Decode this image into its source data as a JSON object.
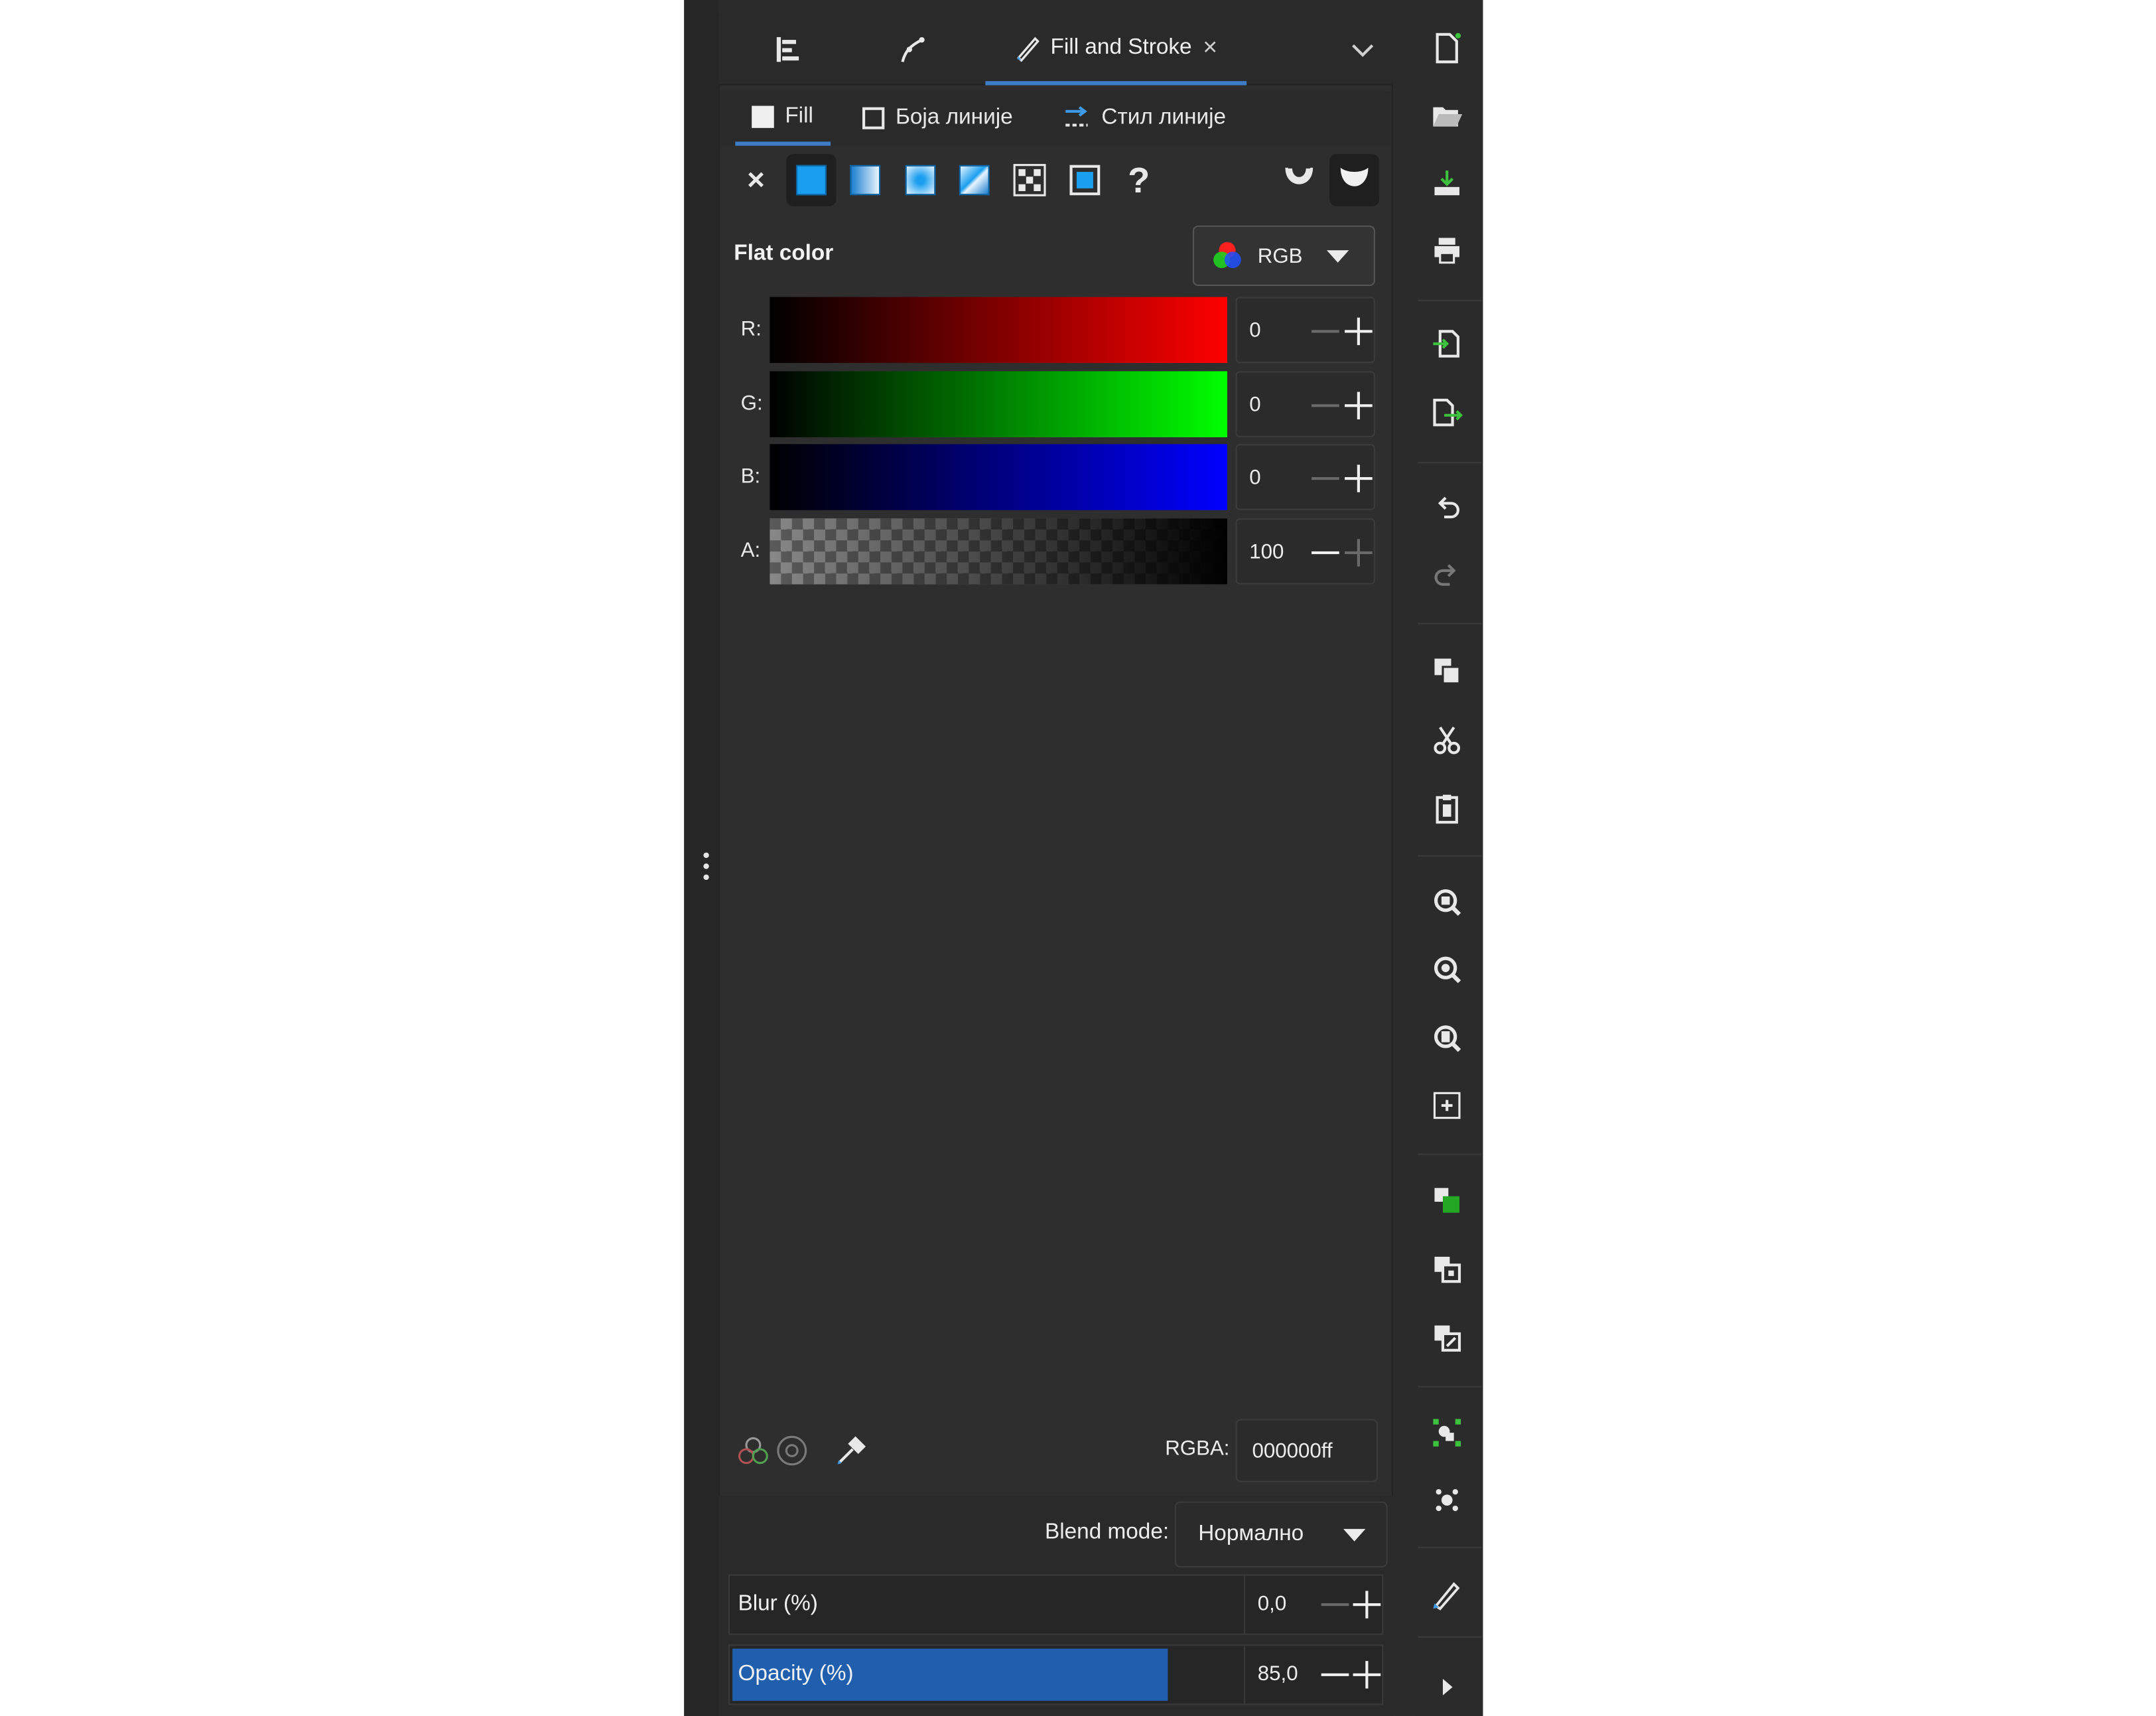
{
  "dock_tabs": [
    {
      "icon": "align-icon",
      "label": ""
    },
    {
      "icon": "node-edit-icon",
      "label": ""
    },
    {
      "icon": "fill-stroke-icon",
      "label": "Fill and Stroke",
      "active": true,
      "close": "×"
    }
  ],
  "sub_tabs": [
    {
      "label": "Fill",
      "active": true
    },
    {
      "label": "Боја линије",
      "active": false
    },
    {
      "label": "Стил линије",
      "active": false
    }
  ],
  "paint_types": [
    {
      "name": "no-paint",
      "glyph": "×"
    },
    {
      "name": "flat-color",
      "active": true
    },
    {
      "name": "linear-gradient"
    },
    {
      "name": "radial-gradient"
    },
    {
      "name": "mesh-gradient"
    },
    {
      "name": "pattern"
    },
    {
      "name": "swatch"
    },
    {
      "name": "unset",
      "glyph": "?"
    }
  ],
  "fill_rule_icons": [
    "fill-rule-evenodd-icon",
    "fill-rule-nonzero-icon"
  ],
  "flat_color": {
    "label": "Flat color",
    "mode": "RGB",
    "channels": [
      {
        "label": "R:",
        "value": "0",
        "color": "#ff0000"
      },
      {
        "label": "G:",
        "value": "0",
        "color": "#00ff00"
      },
      {
        "label": "B:",
        "value": "0",
        "color": "#0000ff"
      },
      {
        "label": "A:",
        "value": "100",
        "color": "#000000"
      }
    ],
    "rgba_label": "RGBA:",
    "rgba_value": "000000ff"
  },
  "blend_mode": {
    "label": "Blend mode:",
    "value": "Нормално"
  },
  "blur": {
    "label": "Blur (%)",
    "value": "0,0",
    "fraction": 0.0
  },
  "opacity": {
    "label": "Opacity (%)",
    "value": "85,0",
    "fraction": 0.85
  },
  "toolbar_icons": [
    "new-document-icon",
    "open-icon",
    "save-icon",
    "print-icon",
    "import-icon",
    "export-icon",
    "undo-icon",
    "redo-icon",
    "copy-icon",
    "cut-icon",
    "paste-icon",
    "zoom-selection-icon",
    "zoom-drawing-icon",
    "zoom-page-icon",
    "zoom-center-icon",
    "duplicate-icon",
    "clone-icon",
    "unlink-clone-icon",
    "group-icon",
    "ungroup-icon",
    "fill-stroke-icon",
    "more-icon"
  ],
  "colors": {
    "accent": "#3d7dc8",
    "opacity_fill": "#1f5fae",
    "panel_bg": "#2e2e2e"
  }
}
